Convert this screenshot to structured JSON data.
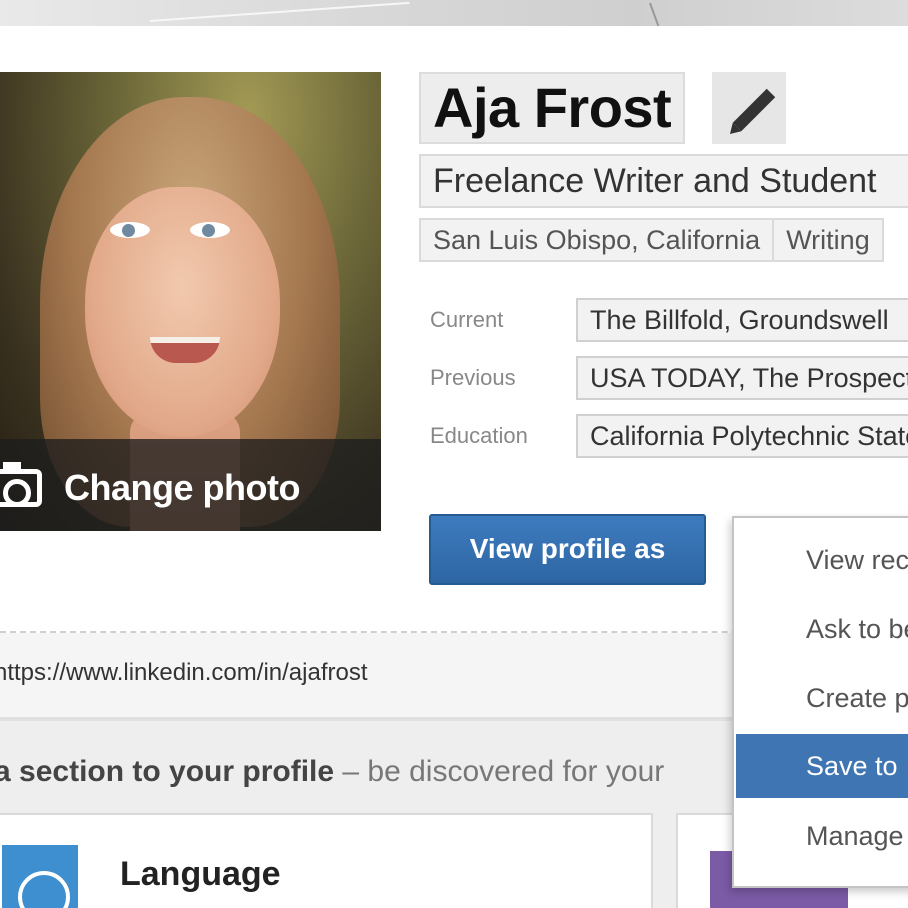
{
  "profile": {
    "name": "Aja Frost",
    "headline": "Freelance Writer and Student",
    "location": "San Luis Obispo, California",
    "industry": "Writing",
    "change_photo_label": "Change photo"
  },
  "details": {
    "current_label": "Current",
    "current_value": "The Billfold, Groundswell",
    "previous_label": "Previous",
    "previous_value": "USA TODAY, The Prospect",
    "education_label": "Education",
    "education_value": "California Polytechnic State"
  },
  "actions": {
    "view_profile_as": "View profile as"
  },
  "dropdown": {
    "items": [
      {
        "label": "View rec"
      },
      {
        "label": "Ask to be"
      },
      {
        "label": "Create p"
      },
      {
        "label": "Save to",
        "active": true
      },
      {
        "label": "Manage"
      }
    ]
  },
  "public_url": "https://www.linkedin.com/in/ajafrost",
  "add_section": {
    "title": "a section to your profile",
    "subtitle": " – be discovered for your",
    "cards": [
      {
        "label": "Language",
        "icon": "globe-icon"
      },
      {
        "label": "",
        "icon": "volunteer-icon"
      }
    ]
  },
  "colors": {
    "primary_button": "#2e66a3",
    "menu_active": "#3e75b2"
  }
}
